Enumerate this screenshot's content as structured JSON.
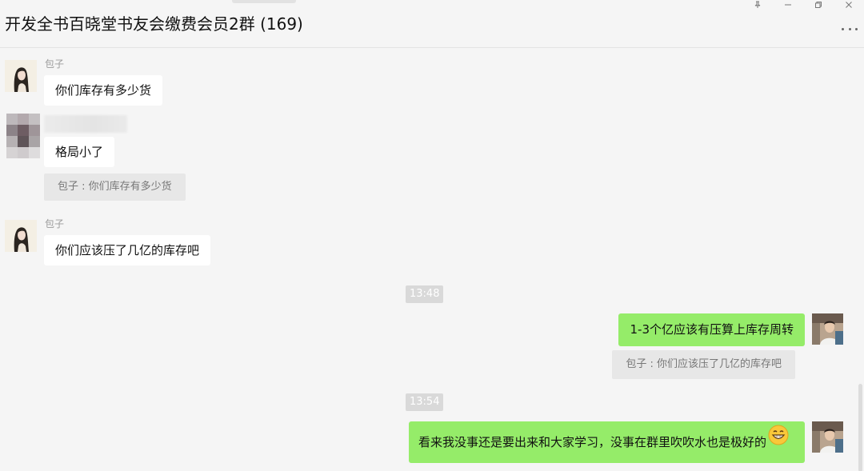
{
  "window": {
    "title": "开发全书百晓堂书友会缴费会员2群 (169)",
    "controls": [
      "pin-icon",
      "minimize-icon",
      "restore-icon",
      "close-icon"
    ],
    "more_icon": "more-dots-icon"
  },
  "colors": {
    "bubble_self": "#95ec69",
    "bubble_other": "#ffffff",
    "background": "#f5f5f5",
    "quote_bg": "#e7e7e7"
  },
  "messages": [
    {
      "sender": "包子",
      "text": "你们库存有多少货",
      "side": "left",
      "avatar": "girl-avatar"
    },
    {
      "sender": "",
      "text": "格局小了",
      "side": "left",
      "avatar": "pixelated-avatar",
      "quote": "包子 : 你们库存有多少货"
    },
    {
      "sender": "包子",
      "text": "你们应该压了几亿的库存吧",
      "side": "left",
      "avatar": "girl-avatar"
    },
    {
      "time": "13:48"
    },
    {
      "sender": "",
      "text": "1-3个亿应该有压算上库存周转",
      "side": "right",
      "avatar": "self-avatar",
      "quote": "包子 : 你们应该压了几亿的库存吧"
    },
    {
      "time": "13:54"
    },
    {
      "sender": "",
      "text": "看来我没事还是要出来和大家学习，没事在群里吹吹水也是极好的",
      "side": "right",
      "avatar": "self-avatar",
      "emoji": "grinning-face-icon"
    }
  ]
}
